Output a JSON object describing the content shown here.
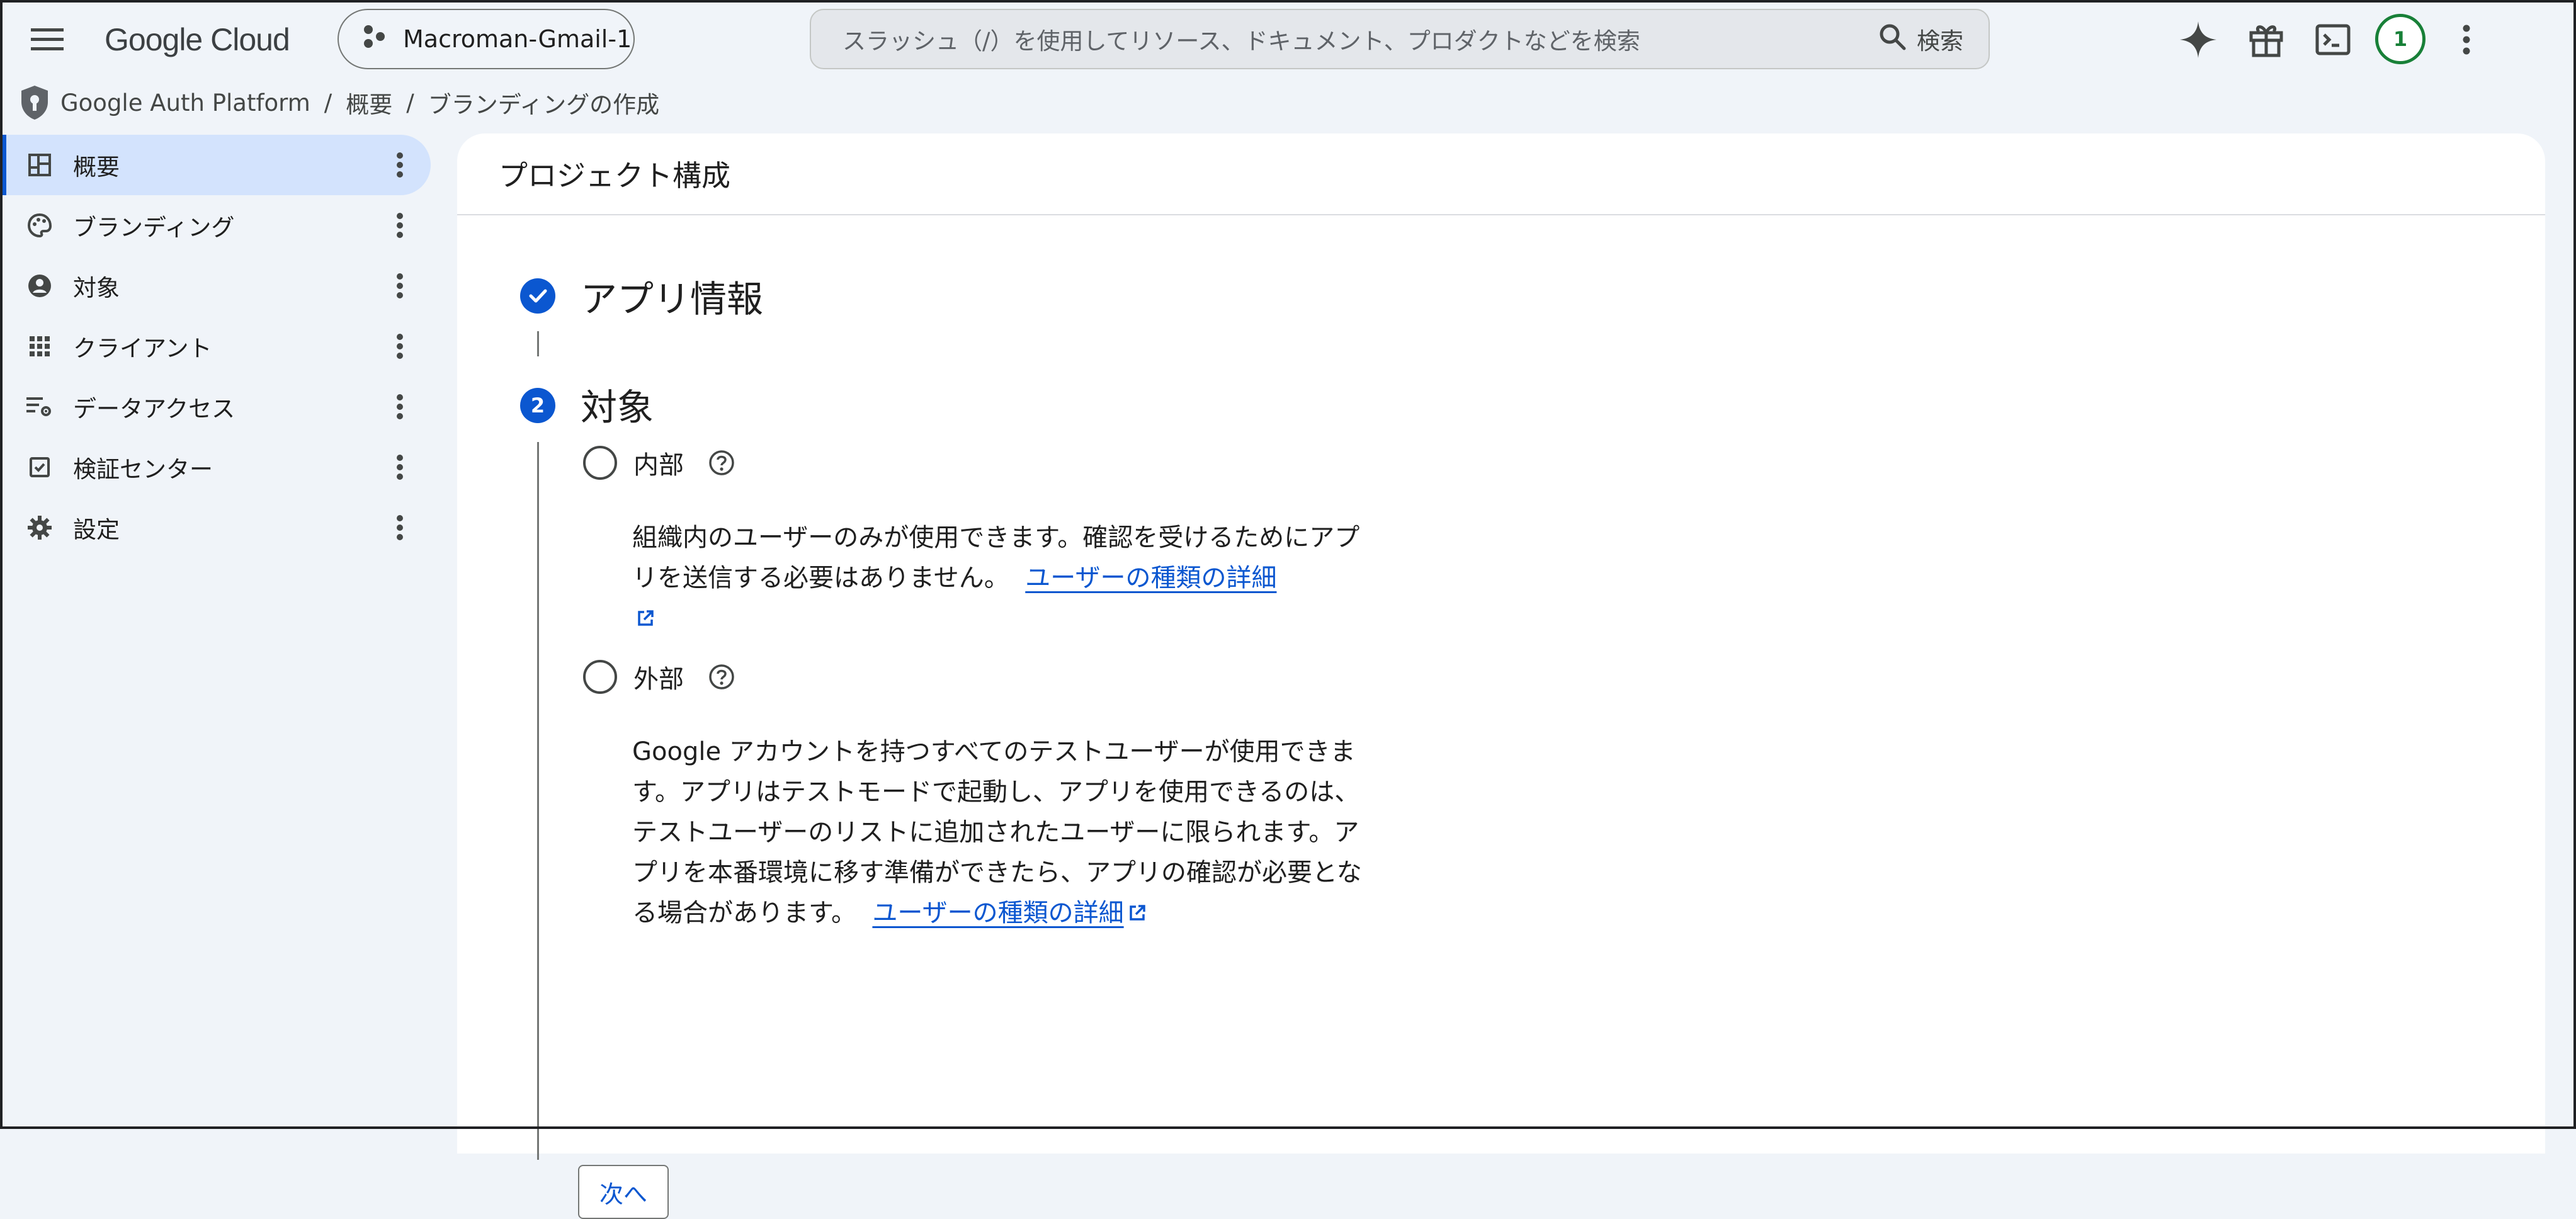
{
  "header": {
    "menu_icon": "hamburger-menu-icon",
    "logo_text": "Google Cloud",
    "project_name": "Macroman-Gmail-1",
    "search_placeholder": "スラッシュ（/）を使用してリソース、ドキュメント、プロダクトなどを検索",
    "search_button_label": "検索",
    "notification_count": "1"
  },
  "breadcrumb": {
    "root": "Google Auth Platform",
    "item1": "概要",
    "item2": "ブランディングの作成"
  },
  "sidebar": {
    "items": [
      {
        "label": "概要",
        "icon": "dashboard-icon",
        "active": true
      },
      {
        "label": "ブランディング",
        "icon": "palette-icon",
        "active": false
      },
      {
        "label": "対象",
        "icon": "account-circle-icon",
        "active": false
      },
      {
        "label": "クライアント",
        "icon": "apps-grid-icon",
        "active": false
      },
      {
        "label": "データアクセス",
        "icon": "data-settings-icon",
        "active": false
      },
      {
        "label": "検証センター",
        "icon": "verification-checkbox-icon",
        "active": false
      },
      {
        "label": "設定",
        "icon": "gear-icon",
        "active": false
      }
    ]
  },
  "main": {
    "title": "プロジェクト構成",
    "step1": {
      "title": "アプリ情報",
      "status": "completed"
    },
    "step2": {
      "number": "2",
      "title": "対象",
      "options": [
        {
          "label": "内部",
          "description": "組織内のユーザーのみが使用できます。確認を受けるためにアプリを送信する必要はありません。",
          "link": "ユーザーの種類の詳細"
        },
        {
          "label": "外部",
          "description": "Google アカウントを持つすべてのテストユーザーが使用できます。アプリはテストモードで起動し、アプリを使用できるのは、テストユーザーのリストに追加されたユーザーに限られます。アプリを本番環境に移す準備ができたら、アプリの確認が必要となる場合があります。",
          "link": "ユーザーの種類の詳細"
        }
      ],
      "next_button": "次へ"
    }
  },
  "colors": {
    "accent": "#0b57d0",
    "active_nav_bg": "#d3e3fd",
    "page_bg": "#f0f4f9",
    "avatar_ring": "#188038"
  }
}
